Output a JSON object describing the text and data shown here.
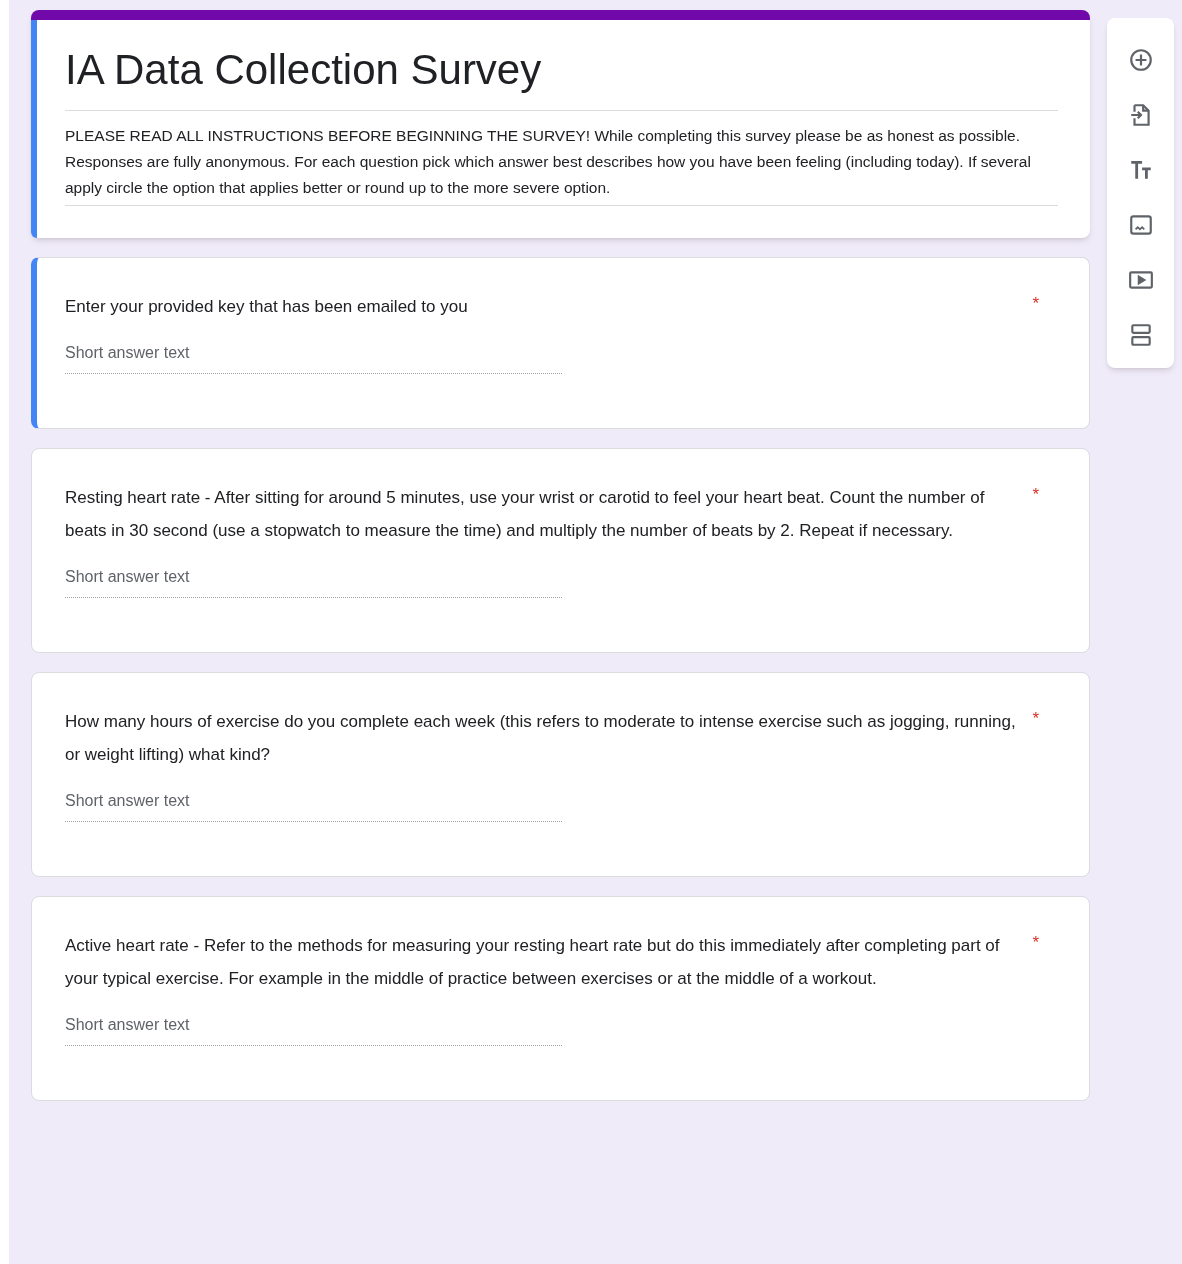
{
  "form": {
    "title": "IA Data Collection Survey",
    "description": "PLEASE READ ALL INSTRUCTIONS BEFORE BEGINNING THE SURVEY! While completing this survey please be as honest as possible. Responses are fully anonymous. For each question pick which answer best describes how you have been feeling (including today). If several apply circle the option that applies better or round up to the more severe option."
  },
  "questions": [
    {
      "text": "Enter your provided key that has been emailed to you",
      "required_mark": "*",
      "placeholder": "Short answer text",
      "selected": true
    },
    {
      "text": "Resting heart rate - After sitting for around 5 minutes, use your wrist or carotid to feel your heart beat. Count the number of beats in 30 second (use a stopwatch to measure the time) and multiply the number of beats by 2. Repeat if necessary.",
      "required_mark": "*",
      "placeholder": "Short answer text",
      "selected": false
    },
    {
      "text": "How many hours of exercise do you complete each week (this refers to moderate to intense exercise such as jogging, running, or weight lifting) what kind?",
      "required_mark": "*",
      "placeholder": "Short answer text",
      "selected": false
    },
    {
      "text": "Active heart rate - Refer to the methods for measuring your resting heart rate but do this immediately after completing part of your typical exercise. For example in the middle of practice between exercises or at the middle of a workout.",
      "required_mark": "*",
      "placeholder": "Short answer text",
      "selected": false
    }
  ]
}
